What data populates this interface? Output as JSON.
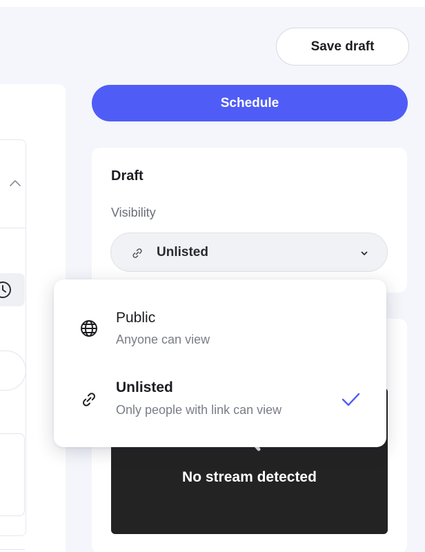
{
  "toolbar": {
    "save_draft_label": "Save draft",
    "schedule_label": "Schedule"
  },
  "draft": {
    "title": "Draft",
    "visibility_label": "Visibility",
    "visibility_value": "Unlisted"
  },
  "visibility_menu": {
    "options": [
      {
        "title": "Public",
        "description": "Anyone can view",
        "icon": "globe-icon",
        "selected": false
      },
      {
        "title": "Unlisted",
        "description": "Only people with link can view",
        "icon": "link-icon",
        "selected": true
      }
    ]
  },
  "stream": {
    "status_text": "No stream detected"
  },
  "colors": {
    "accent": "#4f5df6",
    "background": "#f4f6fb",
    "stream_bg": "#232323"
  }
}
